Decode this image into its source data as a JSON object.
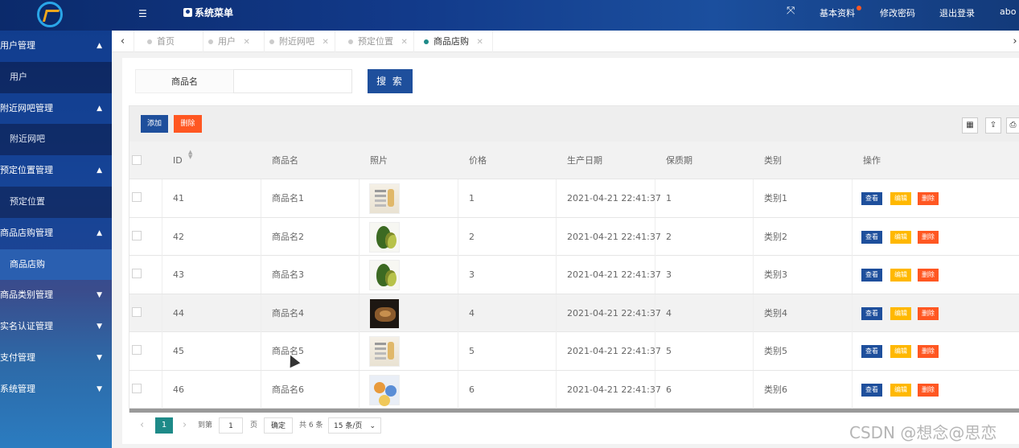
{
  "header": {
    "menu_title": "系统菜单",
    "basic_info": "基本资料",
    "change_password": "修改密码",
    "logout": "退出登录",
    "username": "abo"
  },
  "sidebar": {
    "groups": [
      {
        "label": "用户管理",
        "arrow": "▲",
        "items": [
          "用户"
        ]
      },
      {
        "label": "附近网吧管理",
        "arrow": "▲",
        "items": [
          "附近网吧"
        ]
      },
      {
        "label": "预定位置管理",
        "arrow": "▲",
        "items": [
          "预定位置"
        ]
      },
      {
        "label": "商品店购管理",
        "arrow": "▲",
        "items": [
          "商品店购"
        ]
      },
      {
        "label": "商品类别管理",
        "arrow": "▼",
        "items": []
      },
      {
        "label": "实名认证管理",
        "arrow": "▼",
        "items": []
      },
      {
        "label": "支付管理",
        "arrow": "▼",
        "items": []
      },
      {
        "label": "系统管理",
        "arrow": "▼",
        "items": []
      }
    ]
  },
  "tabs": [
    {
      "label": "首页",
      "active": false,
      "closable": false
    },
    {
      "label": "用户",
      "active": false,
      "closable": true
    },
    {
      "label": "附近网吧",
      "active": false,
      "closable": true
    },
    {
      "label": "预定位置",
      "active": false,
      "closable": true
    },
    {
      "label": "商品店购",
      "active": true,
      "closable": true
    }
  ],
  "search": {
    "label": "商品名",
    "value": "",
    "button": "搜 索"
  },
  "toolbar": {
    "add": "添加",
    "delete": "删除"
  },
  "table": {
    "columns": [
      "ID",
      "商品名",
      "照片",
      "价格",
      "生产日期",
      "保质期",
      "类别",
      "操作"
    ],
    "rows": [
      {
        "id": "41",
        "name": "商品名1",
        "photo": "poster",
        "price": "1",
        "date": "2021-04-21 22:41:37",
        "shelf": "1",
        "category": "类别1"
      },
      {
        "id": "42",
        "name": "商品名2",
        "photo": "avocado",
        "price": "2",
        "date": "2021-04-21 22:41:37",
        "shelf": "2",
        "category": "类别2"
      },
      {
        "id": "43",
        "name": "商品名3",
        "photo": "avocado",
        "price": "3",
        "date": "2021-04-21 22:41:37",
        "shelf": "3",
        "category": "类别3"
      },
      {
        "id": "44",
        "name": "商品名4",
        "photo": "cake",
        "price": "4",
        "date": "2021-04-21 22:41:37",
        "shelf": "4",
        "category": "类别4"
      },
      {
        "id": "45",
        "name": "商品名5",
        "photo": "poster",
        "price": "5",
        "date": "2021-04-21 22:41:37",
        "shelf": "5",
        "category": "类别5"
      },
      {
        "id": "46",
        "name": "商品名6",
        "photo": "fruit",
        "price": "6",
        "date": "2021-04-21 22:41:37",
        "shelf": "6",
        "category": "类别6"
      }
    ],
    "actions": {
      "view": "查看",
      "edit": "编辑",
      "delete": "删除"
    }
  },
  "pager": {
    "current": "1",
    "goto_label": "到第",
    "goto_value": "1",
    "page_unit": "页",
    "confirm": "确定",
    "total": "共 6 条",
    "page_size": "15 条/页"
  },
  "watermark": "CSDN @想念@思恋"
}
